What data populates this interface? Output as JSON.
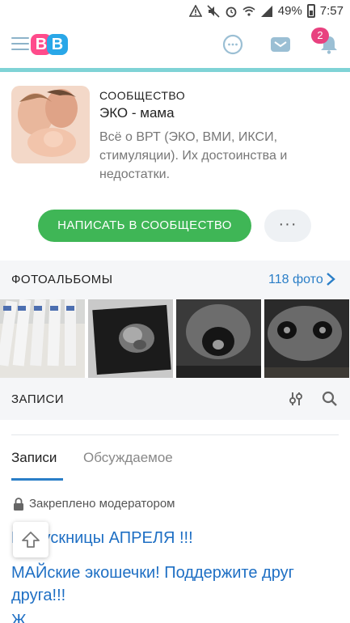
{
  "status_bar": {
    "battery": "49%",
    "time": "7:57"
  },
  "header": {
    "logo_text_1": "B",
    "logo_text_2": "B",
    "notifications_count": "2"
  },
  "community": {
    "label": "СООБЩЕСТВО",
    "title": "ЭКО - мама",
    "description": "Всё о ВРТ (ЭКО, ВМИ, ИКСИ, стимуляции). Их достоинства и недостатки.",
    "write_button": "НАПИСАТЬ В СООБЩЕСТВО",
    "more_button": "···"
  },
  "albums": {
    "title": "ФОТОАЛЬБОМЫ",
    "count": "118 фото"
  },
  "records": {
    "title": "ЗАПИСИ",
    "tabs": [
      {
        "label": "Записи",
        "active": true
      },
      {
        "label": "Обсуждаемое",
        "active": false
      }
    ],
    "pinned_label": "Закреплено модератором",
    "posts": [
      "Выпускницы АПРЕЛЯ !!!",
      "МАЙские экошечки! Поддержите друг друга!!!",
      "Ж"
    ]
  },
  "colors": {
    "accent_green": "#3fb656",
    "link_blue": "#1e6fc4",
    "badge_pink": "#e8417f"
  }
}
